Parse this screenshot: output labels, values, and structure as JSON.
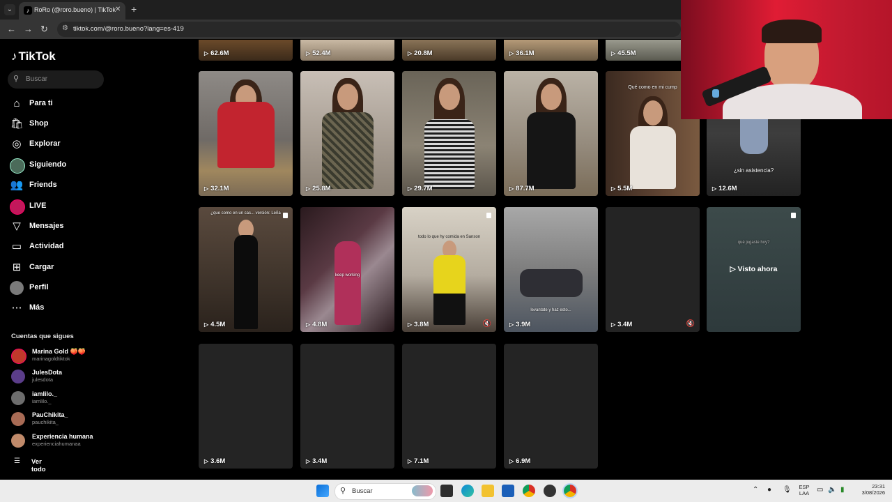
{
  "browser": {
    "tab_title": "RoRo (@roro.bueno) | TikTok",
    "url": "tiktok.com/@roro.bueno?lang=es-419"
  },
  "sidebar": {
    "logo": "TikTok",
    "search_placeholder": "Buscar",
    "nav": [
      {
        "label": "Para ti",
        "icon": "home-icon"
      },
      {
        "label": "Shop",
        "icon": "shopping-bag-icon"
      },
      {
        "label": "Explorar",
        "icon": "compass-icon"
      },
      {
        "label": "Siguiendo",
        "icon": "following-avatar-icon"
      },
      {
        "label": "Friends",
        "icon": "friends-icon"
      },
      {
        "label": "LIVE",
        "icon": "live-avatar-icon"
      },
      {
        "label": "Mensajes",
        "icon": "send-icon"
      },
      {
        "label": "Actividad",
        "icon": "activity-icon"
      },
      {
        "label": "Cargar",
        "icon": "upload-icon"
      },
      {
        "label": "Perfil",
        "icon": "profile-avatar-icon"
      },
      {
        "label": "Más",
        "icon": "more-icon"
      }
    ],
    "following_title": "Cuentas que sigues",
    "accounts": [
      {
        "name": "Marina Gold 🍑🍑",
        "user": "marinagoldtiktok",
        "color": "#c0392b"
      },
      {
        "name": "JulesDota",
        "user": "julesdota",
        "color": "#5b3d8a"
      },
      {
        "name": "iamlilo._",
        "user": "iamlilo._",
        "color": "#6d6d6d"
      },
      {
        "name": "PauChikita_",
        "user": "pauchikita_",
        "color": "#a86b55"
      },
      {
        "name": "Experiencia humana",
        "user": "experienciahumanaa",
        "color": "#c08a6a"
      }
    ],
    "see_all": "Ver todo"
  },
  "grid": {
    "top_row_views": [
      "62.6M",
      "52.4M",
      "20.8M",
      "36.1M",
      "45.5M"
    ],
    "row1": [
      {
        "views": "32.1M",
        "overlay": ""
      },
      {
        "views": "25.8M",
        "overlay": ""
      },
      {
        "views": "29.7M",
        "overlay": ""
      },
      {
        "views": "87.7M",
        "overlay": ""
      },
      {
        "views": "5.5M",
        "overlay": "Qué como en mi cump"
      },
      {
        "views": "12.6M",
        "overlay": "¿sin asistencia?"
      }
    ],
    "row2": [
      {
        "views": "4.5M",
        "overlay": "¿que como en un cas... versión: Leña"
      },
      {
        "views": "4.8M",
        "overlay": "keep working"
      },
      {
        "views": "3.8M",
        "overlay": "todo lo que hy comida en Sanson"
      },
      {
        "views": "3.9M",
        "overlay": "levantate y haz esto..."
      },
      {
        "views": "3.4M",
        "overlay": ""
      },
      {
        "views": "",
        "overlay": "qué jugaste hoy?"
      }
    ],
    "watched_label": "Visto ahora",
    "row3": [
      {
        "views": "3.6M"
      },
      {
        "views": "3.4M"
      },
      {
        "views": "7.1M"
      },
      {
        "views": "6.9M"
      }
    ]
  },
  "taskbar": {
    "search_label": "Buscar",
    "lang_top": "ESP",
    "lang_bottom": "LAA",
    "time": "23:31",
    "date": "3/08/2026"
  }
}
